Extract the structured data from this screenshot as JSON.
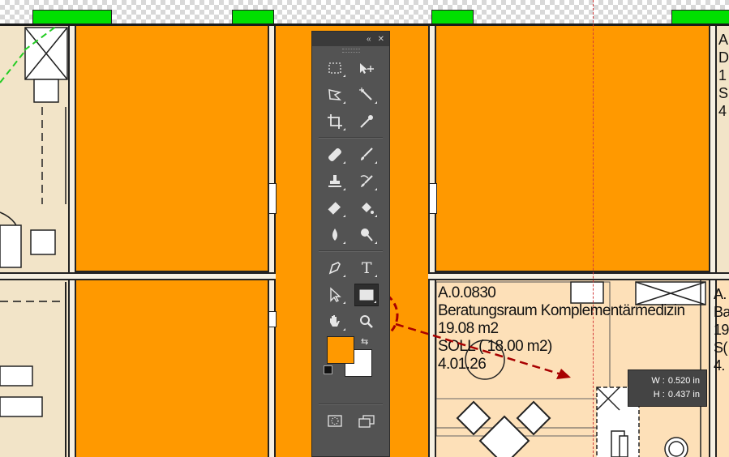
{
  "toolbar": {
    "collapse_label": "«",
    "close_label": "✕",
    "rows": [
      [
        "rectangular-marquee-tool",
        "move-tool"
      ],
      [
        "polygonal-lasso-tool",
        "magic-wand-tool"
      ],
      [
        "crop-tool",
        "eyedropper-tool"
      ],
      [
        "spot-healing-brush-tool",
        "brush-tool"
      ],
      [
        "clone-stamp-tool",
        "history-brush-tool"
      ],
      [
        "eraser-tool",
        "paint-bucket-tool"
      ],
      [
        "blur-tool",
        "dodge-tool"
      ],
      [
        "pen-tool",
        "type-tool"
      ],
      [
        "path-selection-tool",
        "rectangle-tool"
      ],
      [
        "hand-tool",
        "zoom-tool"
      ]
    ],
    "type_glyph": "T",
    "foreground_color": "#ff9900",
    "background_color": "#ffffff",
    "active_tool": "rectangle-tool"
  },
  "room": {
    "id": "A.0.0830",
    "name": "Beratungsraum Komplementärmedizin",
    "area": "19.08 m2",
    "target": "SOLL ( 18.00 m2)",
    "code": "4.01.26"
  },
  "edge_texts": {
    "right_top": [
      "A",
      "D",
      "1",
      "S",
      "4"
    ],
    "right_bottom": [
      "A.",
      "Ba",
      "19",
      "S(",
      "4."
    ]
  },
  "measure_tooltip": {
    "w_label": "W :",
    "w_value": "0.520 in",
    "h_label": "H :",
    "h_value": "0.437 in"
  },
  "colors": {
    "fill_orange": "#ff9900",
    "room_beige": "#fde0b8",
    "annotation_red": "#a80000",
    "toolbar_bg": "#535353"
  }
}
